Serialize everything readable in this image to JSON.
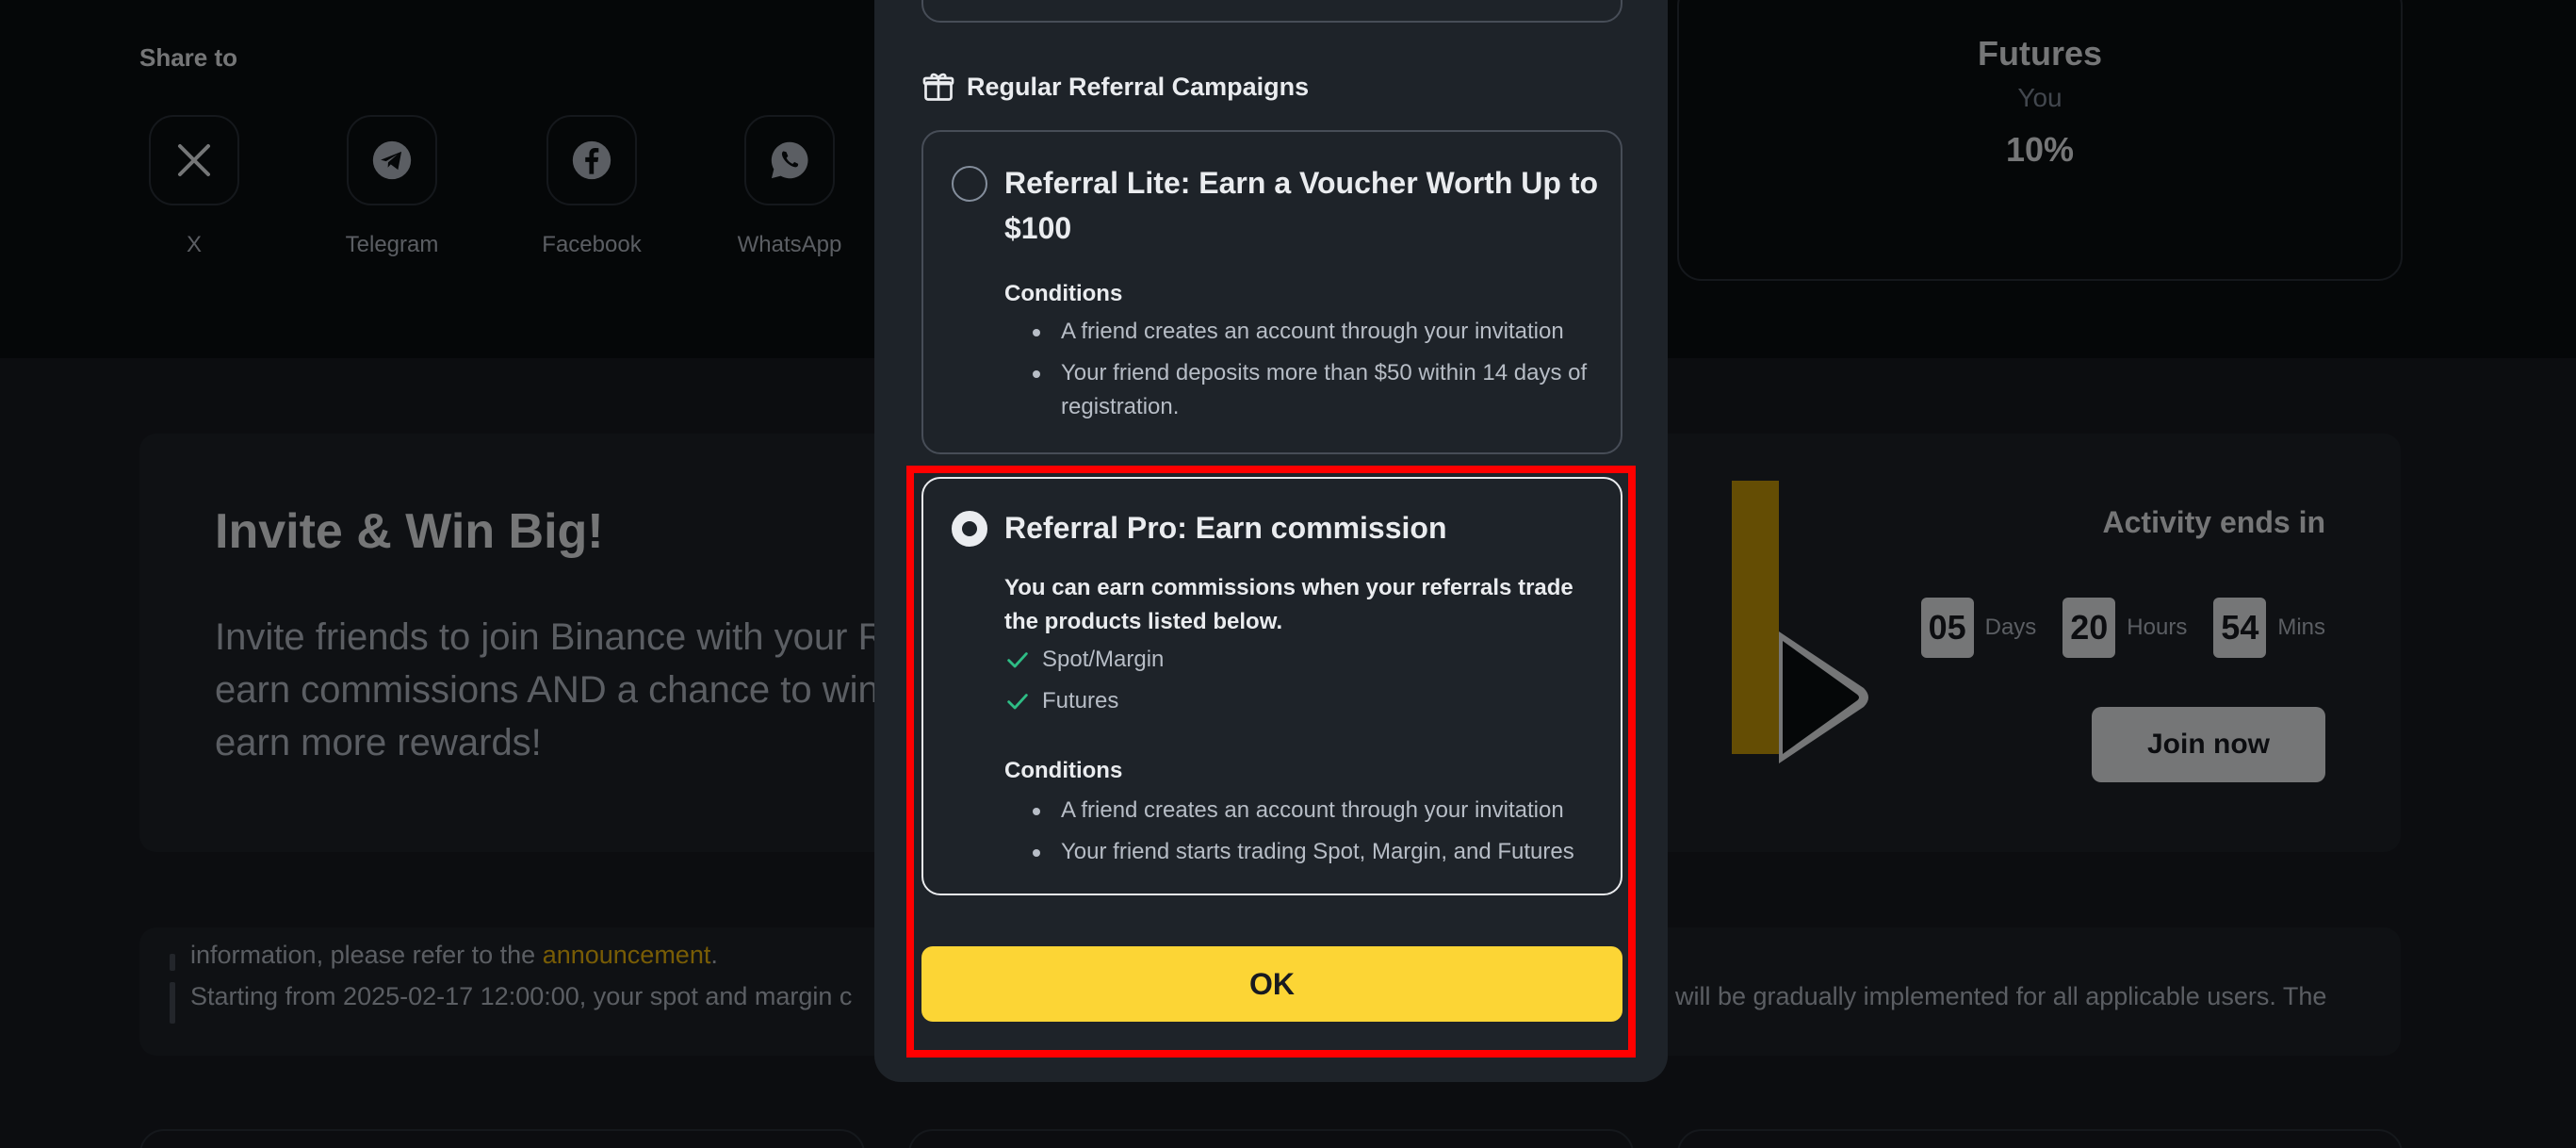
{
  "share": {
    "title": "Share to",
    "items": [
      {
        "label": "X",
        "icon": "x-logo-icon"
      },
      {
        "label": "Telegram",
        "icon": "telegram-icon"
      },
      {
        "label": "Facebook",
        "icon": "facebook-icon"
      },
      {
        "label": "WhatsApp",
        "icon": "whatsapp-icon"
      }
    ]
  },
  "futures_card": {
    "title": "Futures",
    "who": "You",
    "rate": "10%"
  },
  "invite": {
    "title": "Invite & Win Big!",
    "description": "Invite friends to join Binance with your R\nearn commissions AND a chance to win\nearn more rewards!",
    "activity_label": "Activity ends in",
    "countdown": {
      "days": "05",
      "days_unit": "Days",
      "hours": "20",
      "hours_unit": "Hours",
      "mins": "54",
      "mins_unit": "Mins"
    },
    "join_label": "Join now"
  },
  "notice": {
    "line1_text": "information, please refer to the ",
    "line1_link": "announcement",
    "line1_end": ".",
    "line2_text": "Starting from 2025-02-17 12:00:00, your spot and margin c",
    "line2_tail": "will be gradually implemented for all applicable users. The"
  },
  "modal": {
    "section_title": "Regular Referral Campaigns",
    "lite": {
      "title": "Referral Lite: Earn a Voucher Worth Up to $100",
      "conditions_title": "Conditions",
      "conditions": [
        "A friend creates an account through your invitation",
        "Your friend deposits more than $50 within 14 days of registration."
      ]
    },
    "pro": {
      "title": "Referral Pro: Earn commission",
      "description": "You can earn commissions when your referrals trade the products listed below.",
      "products": [
        "Spot/Margin",
        "Futures"
      ],
      "conditions_title": "Conditions",
      "conditions": [
        "A friend creates an account through your invitation",
        "Your friend starts trading Spot, Margin, and Futures"
      ]
    },
    "ok_label": "OK"
  },
  "colors": {
    "accent": "#fcd535",
    "highlight": "#ff0000",
    "check": "#2ebd85"
  }
}
